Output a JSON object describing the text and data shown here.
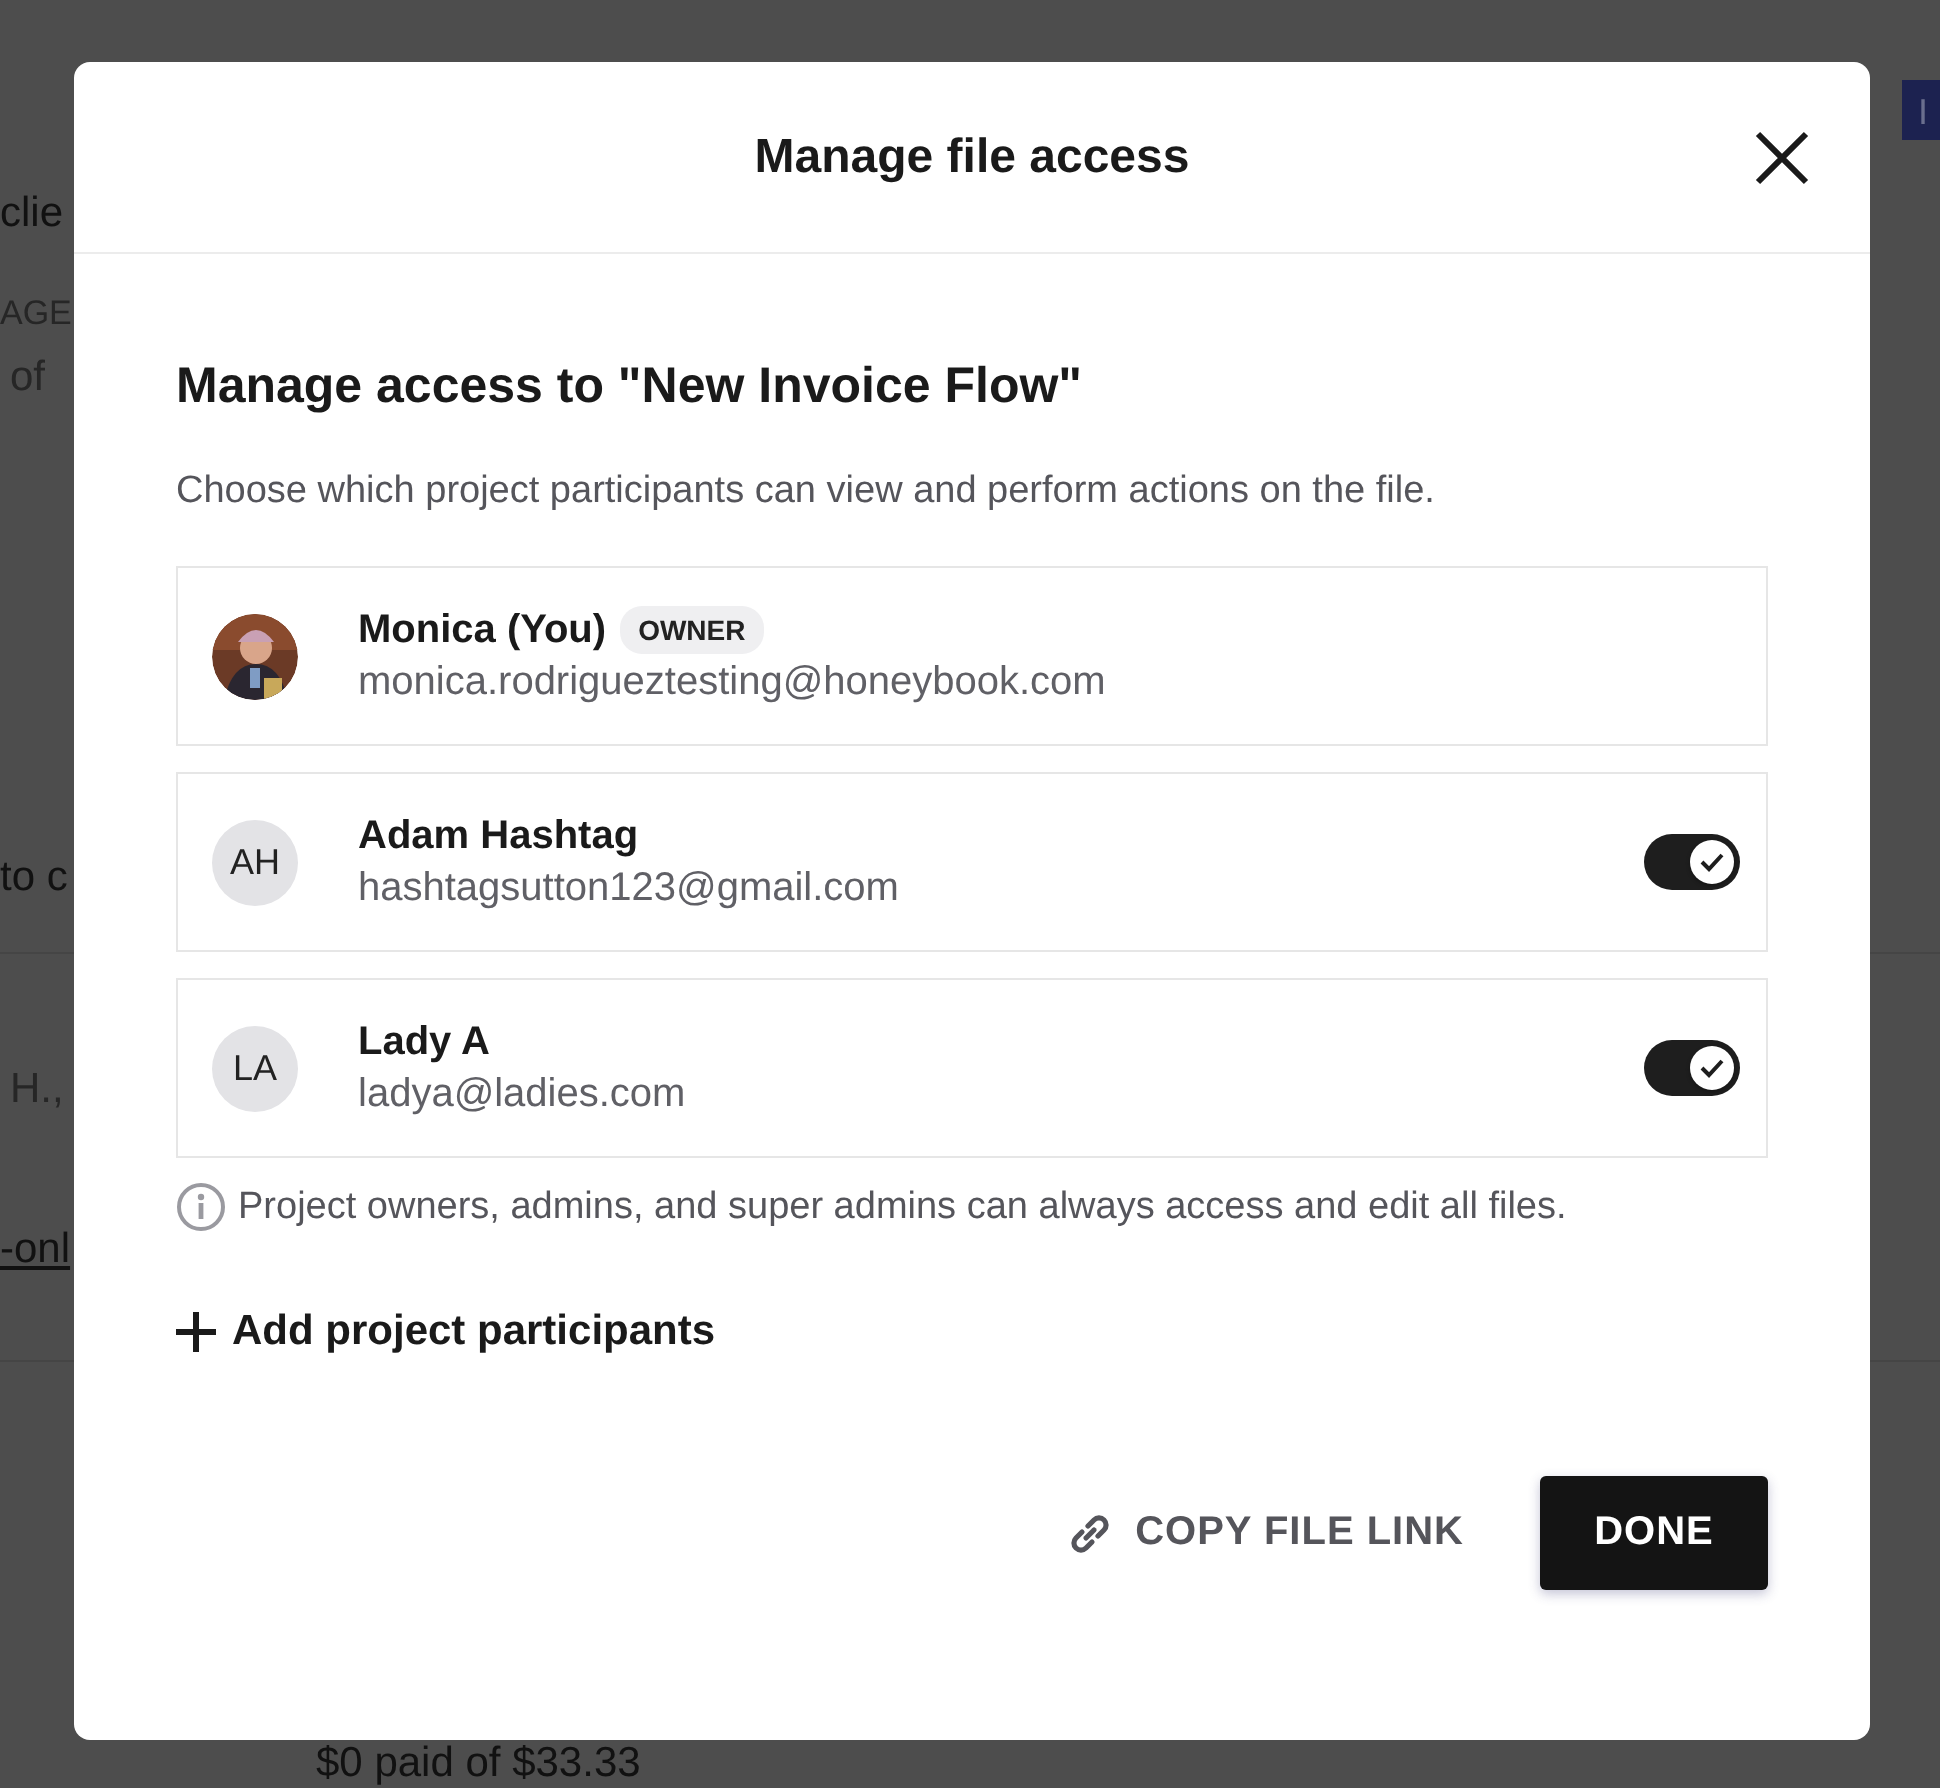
{
  "background": {
    "fragments": [
      {
        "text": "clie",
        "kind": "text"
      },
      {
        "text": "AGE",
        "kind": "muted"
      },
      {
        "text": "of",
        "kind": "muted"
      },
      {
        "text": "to c",
        "kind": "text"
      },
      {
        "text": "H.,",
        "kind": "muted"
      },
      {
        "text": "-onl",
        "kind": "link"
      },
      {
        "text": "$0 paid of $33.33",
        "kind": "text"
      }
    ],
    "corner_button": "I"
  },
  "modal": {
    "title": "Manage file access",
    "heading": "Manage access to \"New Invoice Flow\"",
    "description": "Choose which project participants can view and perform actions on the file.",
    "participants": [
      {
        "kind": "owner",
        "name": "Monica (You)",
        "badge": "OWNER",
        "email": "monica.rodrigueztesting@honeybook.com"
      },
      {
        "kind": "member",
        "initials": "AH",
        "name": "Adam Hashtag",
        "email": "hashtagsutton123@gmail.com",
        "on": true
      },
      {
        "kind": "member",
        "initials": "LA",
        "name": "Lady A",
        "email": "ladya@ladies.com",
        "on": true
      }
    ],
    "note": "Project owners, admins, and super admins can always access and edit all files.",
    "add_label": "Add project participants",
    "copy_link_label": "COPY FILE LINK",
    "done_label": "DONE"
  }
}
